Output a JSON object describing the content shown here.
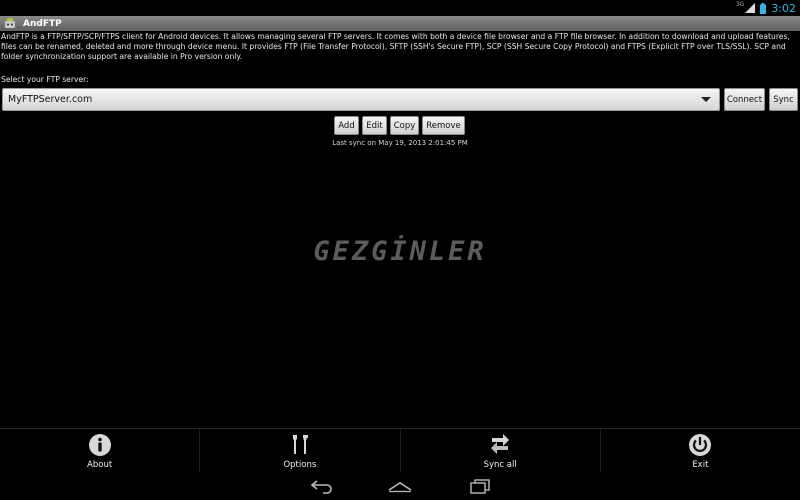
{
  "status": {
    "network_label": "3G",
    "time": "3:02",
    "icons": [
      "signal-icon",
      "battery-icon"
    ]
  },
  "app": {
    "title": "AndFTP",
    "icon": "android-app-icon"
  },
  "description": "AndFTP is a FTP/SFTP/SCP/FTPS client for Android devices. It allows managing several FTP servers. It comes with both a device file browser and a FTP file browser. In addition to download and upload features, files can be renamed, deleted and more through device menu. It provides FTP (File Transfer Protocol), SFTP (SSH's Secure FTP), SCP (SSH Secure Copy Protocol) and FTPS (Explicit FTP over TLS/SSL). SCP and folder synchronization support are available in Pro version only.",
  "server": {
    "label": "Select your FTP server:",
    "selected": "MyFTPServer.com",
    "connect_label": "Connect",
    "sync_label": "Sync"
  },
  "server_actions": {
    "add_label": "Add",
    "edit_label": "Edit",
    "copy_label": "Copy",
    "remove_label": "Remove"
  },
  "last_sync": "Last sync on May 19, 2013 2:01:45 PM",
  "watermark": "GEZGİNLER",
  "action_bar": [
    {
      "label": "About",
      "icon": "info-icon"
    },
    {
      "label": "Options",
      "icon": "tools-icon"
    },
    {
      "label": "Sync all",
      "icon": "sync-arrows-icon"
    },
    {
      "label": "Exit",
      "icon": "power-icon"
    }
  ],
  "nav": [
    "back-icon",
    "home-icon",
    "recent-apps-icon"
  ],
  "colors": {
    "accent": "#33b5e5",
    "background": "#000000",
    "title_bar": "#707070"
  }
}
